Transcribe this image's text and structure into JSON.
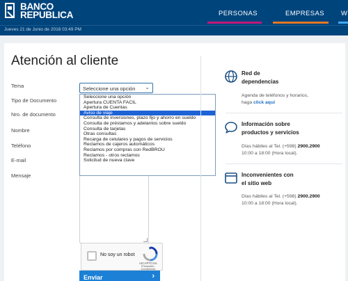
{
  "header": {
    "logo_line1": "BANCO",
    "logo_line2": "REPUBLICA",
    "nav": [
      {
        "label": "PERSONAS",
        "color": "#c2187a"
      },
      {
        "label": "EMPRESAS",
        "color": "#e87722"
      },
      {
        "label": "WEB",
        "color": "#3fa9f5"
      }
    ],
    "date": "Jueves 21 de Junio de 2018  03:49 PM"
  },
  "form": {
    "title": "Atención al cliente",
    "labels": {
      "tema": "Tema",
      "tipo_documento": "Tipo de Documento",
      "nro_documento": "Nro. de documento",
      "nombre": "Nombre",
      "telefono": "Teléfono",
      "email": "E-mail",
      "mensaje": "Mensaje"
    },
    "tema_selected": "Seleccione una opción",
    "tema_options": [
      "Seleccione una opción",
      "Apertura CUENTA FACIL",
      "Apertura de Cuentas",
      "Aviso de viaje",
      "Consulta de inversiones, plazo fijo y ahorro en sueldo",
      "Consulta de préstamos y adelantos sobre sueldo",
      "Consulta de tarjetas",
      "Otras consultas",
      "Recarga de celulares y pagos de servicios",
      "Reclamos de cajeros automáticos",
      "Reclamos por compras con RedBROU",
      "Reclamos - otros reclamos",
      "Solicitud de nueva clave"
    ],
    "highlighted_index": 3,
    "captcha": {
      "label": "No soy un robot",
      "brand": "reCAPTCHA",
      "terms": "Privacidad - Condiciones"
    },
    "send_label": "Enviar"
  },
  "sidebar": {
    "red": {
      "title_1": "Red de",
      "title_2": "dependencias",
      "desc": "Agenda de teléfonos y horarios,",
      "link_prefix": "haga",
      "link_text": "click aquí",
      "icon": "globe-icon"
    },
    "productos": {
      "title_1": "Información sobre",
      "title_2": "productos y servicios",
      "hours_prefix": "Días hábiles al Tel. (+598)",
      "phone": "2900.2900",
      "hours_line2": "10:00 a 18:00 (Hora local).",
      "icon": "chat-icon"
    },
    "sitio": {
      "title_1": "Inconvenientes con",
      "title_2": "el sitio web",
      "hours_prefix": "Días hábiles al Tel. (+598)",
      "phone": "2900.2900",
      "hours_line2": "10:00 a 18:00 (Hora local).",
      "icon": "browser-icon"
    }
  }
}
